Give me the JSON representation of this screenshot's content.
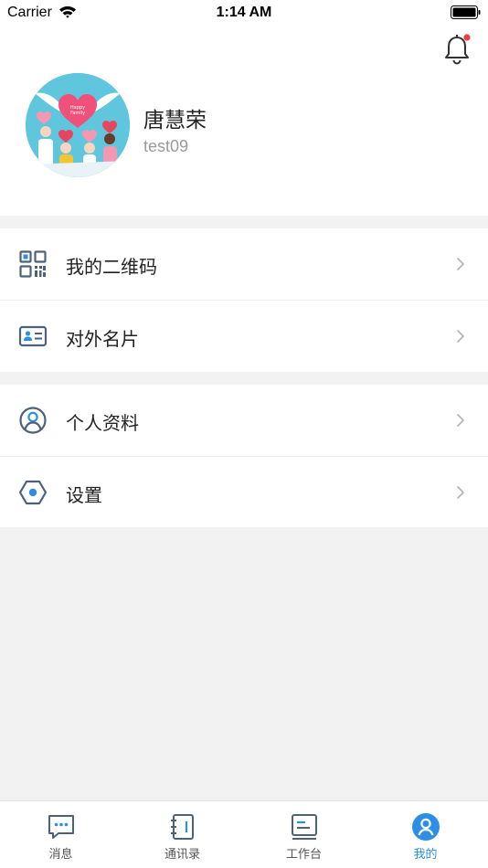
{
  "status_bar": {
    "carrier": "Carrier",
    "time": "1:14 AM"
  },
  "profile": {
    "name": "唐慧荣",
    "account": "test09",
    "notification_icon": "bell-icon",
    "has_unread_dot": true,
    "avatar_image_text": [
      "Happy",
      "Family"
    ]
  },
  "menu_group_1": [
    {
      "label": "我的二维码",
      "icon": "qr-code-icon"
    },
    {
      "label": "对外名片",
      "icon": "business-card-icon"
    }
  ],
  "menu_group_2": [
    {
      "label": "个人资料",
      "icon": "user-profile-icon"
    },
    {
      "label": "设置",
      "icon": "settings-hexagon-icon"
    }
  ],
  "tab_bar": {
    "tabs": [
      {
        "label": "消息",
        "icon": "message-icon",
        "active": false
      },
      {
        "label": "通讯录",
        "icon": "contacts-book-icon",
        "active": false
      },
      {
        "label": "工作台",
        "icon": "workbench-icon",
        "active": false
      },
      {
        "label": "我的",
        "icon": "me-icon",
        "active": true
      }
    ]
  },
  "colors": {
    "accent": "#2d8ee6",
    "icon_gray": "#4e6277",
    "badge_red": "#ef3b3b",
    "avatar_bg": "#5fc6de",
    "page_bg": "#f2f2f2"
  }
}
